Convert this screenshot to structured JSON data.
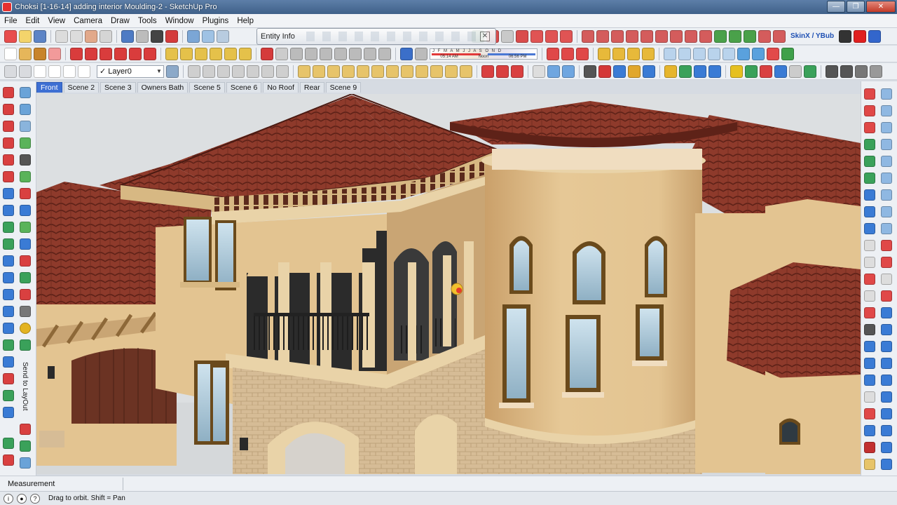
{
  "window": {
    "title": "Choksi [1-16-14] adding interior Moulding-2 - SketchUp Pro",
    "minimize": "—",
    "maximize": "❐",
    "close": "✕"
  },
  "menu": [
    "File",
    "Edit",
    "View",
    "Camera",
    "Draw",
    "Tools",
    "Window",
    "Plugins",
    "Help"
  ],
  "entity_info": {
    "title": "Entity Info",
    "close": "✕"
  },
  "layer_select": {
    "check": "✓",
    "value": "Layer0"
  },
  "shadow_settings": {
    "months": "J F M A M J J A S O N D",
    "times": [
      "05:14 AM",
      "Noon",
      "06:56 PM"
    ]
  },
  "plugin_label": "SkinX / YBub",
  "scenes": {
    "tabs": [
      "Front",
      "Scene 2",
      "Scene 3",
      "Owners Bath",
      "Scene 5",
      "Scene 6",
      "No Roof",
      "Rear",
      "Scene 9"
    ],
    "active": "Front"
  },
  "side_panel": {
    "send_to_layout": "Send to LayOut"
  },
  "measurements": {
    "label": "Measurement",
    "value": ""
  },
  "status": {
    "icons": [
      "info-icon",
      "credit-icon",
      "help-icon"
    ],
    "hint": "Drag to orbit.  Shift = Pan"
  },
  "colors": {
    "roof": "#8e3a2b",
    "roof_dark": "#5e2218",
    "stucco": "#e3c491",
    "stucco_shade": "#c9a574",
    "stone": "#d6bc96",
    "window_frame": "#6a4a1c",
    "door": "#6b3323",
    "ground": "#dcdfe1",
    "accent_blue": "#3d6fd3"
  }
}
